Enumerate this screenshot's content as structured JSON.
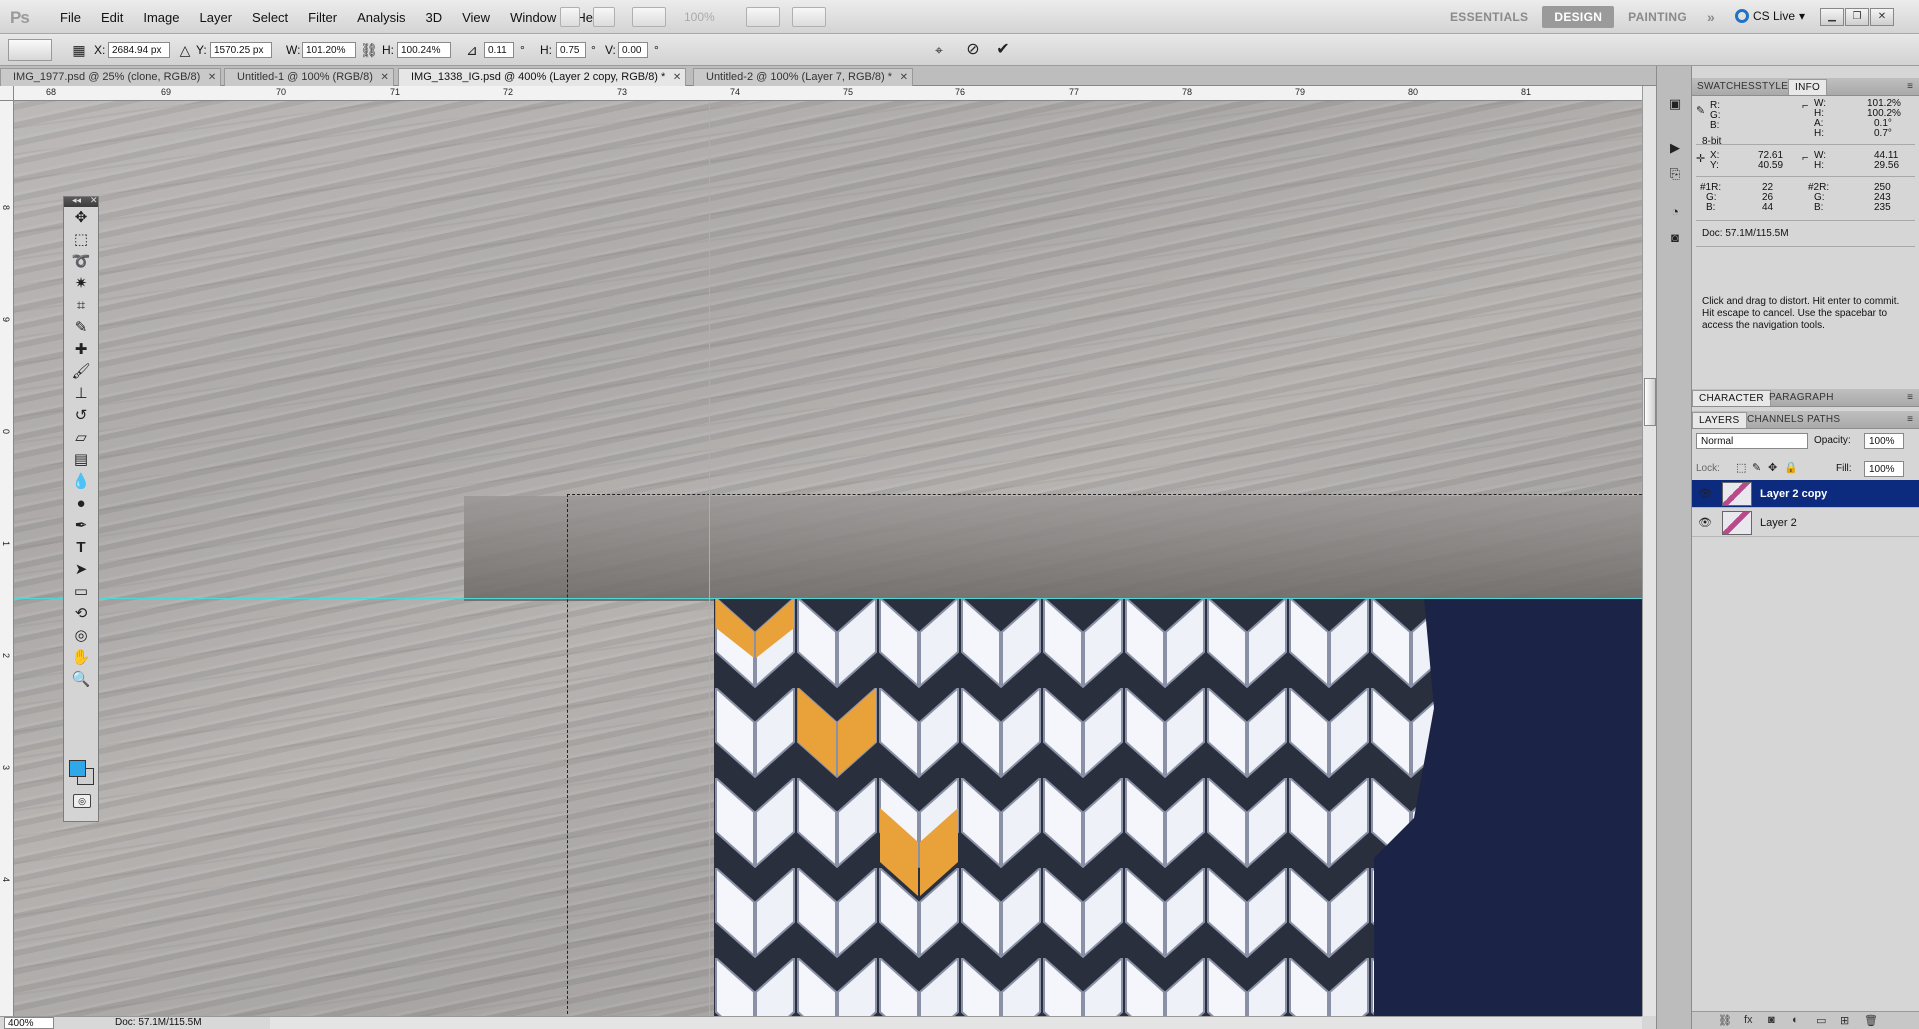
{
  "app": {
    "logo": "Ps"
  },
  "menu": [
    "File",
    "Edit",
    "Image",
    "Layer",
    "Select",
    "Filter",
    "Analysis",
    "3D",
    "View",
    "Window",
    "Help"
  ],
  "menubar": {
    "zoom_level": "100%",
    "workspaces": [
      "ESSENTIALS",
      "DESIGN",
      "PAINTING"
    ],
    "active_workspace": "DESIGN",
    "more": "»",
    "cs_live": "CS Live"
  },
  "options": {
    "x_label": "X:",
    "x_value": "2684.94 px",
    "y_label": "Y:",
    "y_value": "1570.25 px",
    "w_label": "W:",
    "w_value": "101.20%",
    "h_label": "H:",
    "h_value": "100.24%",
    "angle_value": "0.11",
    "angle_unit": "°",
    "hskew_label": "H:",
    "hskew_value": "0.75",
    "hskew_unit": "°",
    "vskew_label": "V:",
    "vskew_value": "0.00",
    "vskew_unit": "°",
    "cancel_icon": "⊘",
    "commit_icon": "✔"
  },
  "doc_tabs": [
    {
      "label": "IMG_1977.psd @ 25% (clone, RGB/8)",
      "active": false
    },
    {
      "label": "Untitled-1 @ 100% (RGB/8)",
      "active": false
    },
    {
      "label": "IMG_1338_IG.psd @ 400% (Layer 2 copy, RGB/8) *",
      "active": true
    },
    {
      "label": "Untitled-2 @ 100% (Layer 7, RGB/8) *",
      "active": false
    }
  ],
  "ruler_top": [
    "68",
    "69",
    "70",
    "71",
    "72",
    "73",
    "74",
    "75",
    "76",
    "77",
    "78",
    "79",
    "80",
    "81"
  ],
  "ruler_left": [
    "8",
    "9",
    "0",
    "1",
    "2",
    "3",
    "4"
  ],
  "status": {
    "zoom": "400%",
    "doc": "Doc: 57.1M/115.5M"
  },
  "colors": {
    "foreground": "#2ea8e8",
    "background": "#cfcfcf",
    "guide": "#4fd6d6",
    "selected_layer": "#0c2a7e"
  },
  "panels": {
    "top_tabs": [
      "SWATCHES",
      "STYLES",
      "INFO"
    ],
    "active_top_tab": "INFO",
    "info": {
      "r": "R:",
      "g": "G:",
      "b": "B:",
      "bit": "8-bit",
      "w_label": "W:",
      "w": "101.2%",
      "h_label": "H:",
      "h": "100.2%",
      "a_label": "A:",
      "a": "0.1°",
      "hh_label": "H:",
      "hh": "0.7°",
      "x_label": "X:",
      "x": "72.61",
      "y_label": "Y:",
      "y": "40.59",
      "w2_label": "W:",
      "w2": "44.11",
      "h2_label": "H:",
      "h2": "29.56",
      "s1r_label": "#1R:",
      "s1r": "22",
      "s1g_label": "G:",
      "s1g": "26",
      "s1b_label": "B:",
      "s1b": "44",
      "s2r_label": "#2R:",
      "s2r": "250",
      "s2g_label": "G:",
      "s2g": "243",
      "s2b_label": "B:",
      "s2b": "235",
      "doc": "Doc: 57.1M/115.5M",
      "hint": "Click and drag to distort. Hit enter to commit. Hit escape to cancel. Use the spacebar to access the navigation tools."
    },
    "mid_tabs": [
      "CHARACTER",
      "PARAGRAPH"
    ],
    "layer_tabs": [
      "LAYERS",
      "CHANNELS",
      "PATHS"
    ],
    "blend_mode": "Normal",
    "opacity_label": "Opacity:",
    "opacity": "100%",
    "lock_label": "Lock:",
    "fill_label": "Fill:",
    "fill": "100%",
    "layers": [
      {
        "name": "Layer 2 copy",
        "selected": true
      },
      {
        "name": "Layer 2",
        "selected": false
      }
    ]
  }
}
